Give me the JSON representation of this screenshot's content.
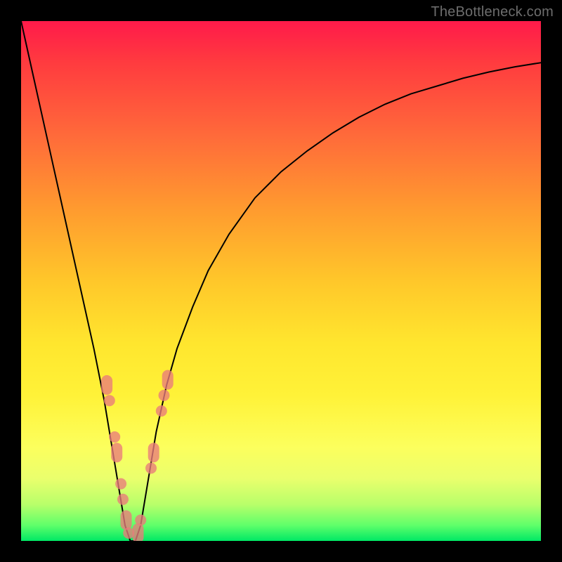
{
  "watermark": "TheBottleneck.com",
  "chart_data": {
    "type": "line",
    "title": "",
    "xlabel": "",
    "ylabel": "",
    "xlim": [
      0,
      100
    ],
    "ylim": [
      0,
      100
    ],
    "grid": false,
    "legend": false,
    "series": [
      {
        "name": "curve",
        "x": [
          0,
          2,
          4,
          6,
          8,
          10,
          12,
          14,
          16,
          18,
          19,
          20,
          21,
          22,
          23,
          24,
          25,
          26,
          28,
          30,
          33,
          36,
          40,
          45,
          50,
          55,
          60,
          65,
          70,
          75,
          80,
          85,
          90,
          95,
          100
        ],
        "values": [
          100,
          91,
          82,
          73,
          64,
          55,
          46,
          37,
          27,
          15,
          9,
          3,
          0,
          0,
          3,
          9,
          15,
          21,
          30,
          37,
          45,
          52,
          59,
          66,
          71,
          75,
          78.5,
          81.5,
          84,
          86,
          87.5,
          89,
          90.2,
          91.2,
          92
        ]
      }
    ],
    "markers_left": [
      {
        "x": 16.5,
        "y": 30
      },
      {
        "x": 17.0,
        "y": 27
      },
      {
        "x": 18.0,
        "y": 20
      },
      {
        "x": 18.4,
        "y": 17
      },
      {
        "x": 19.2,
        "y": 11
      },
      {
        "x": 19.6,
        "y": 8
      },
      {
        "x": 20.2,
        "y": 4
      },
      {
        "x": 20.7,
        "y": 1.5
      }
    ],
    "markers_right": [
      {
        "x": 22.5,
        "y": 1.5
      },
      {
        "x": 23.0,
        "y": 4
      },
      {
        "x": 25.0,
        "y": 14
      },
      {
        "x": 25.5,
        "y": 17
      },
      {
        "x": 27.0,
        "y": 25
      },
      {
        "x": 27.5,
        "y": 28
      },
      {
        "x": 28.2,
        "y": 31
      }
    ],
    "marker_note": "salmon semi-transparent markers clustered near the valley"
  }
}
